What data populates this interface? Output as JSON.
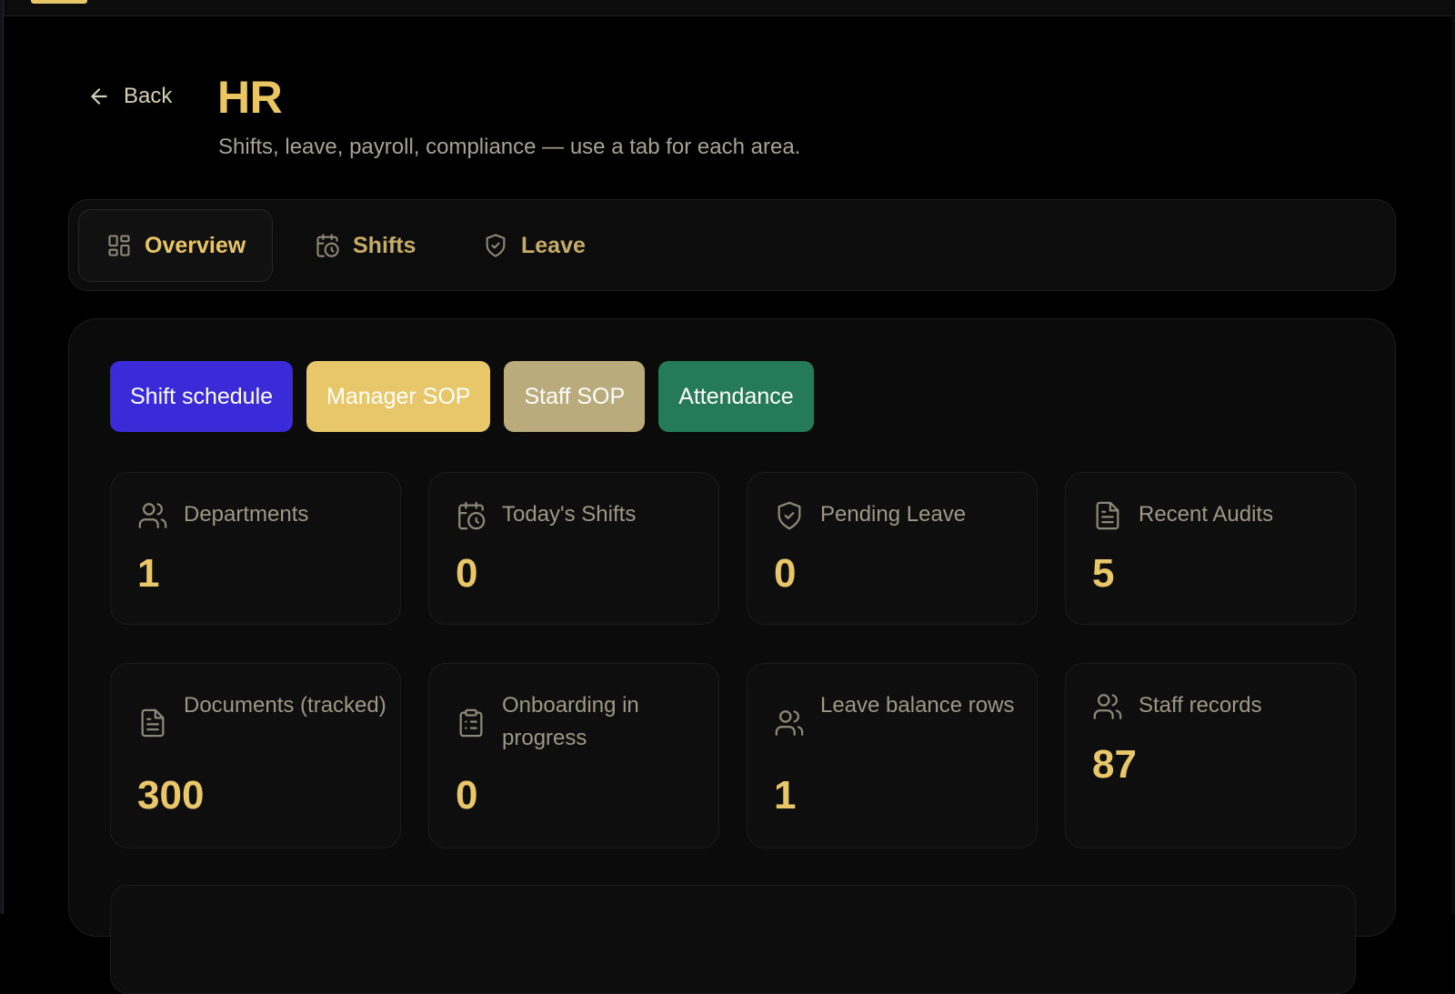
{
  "header": {
    "back_label": "Back",
    "title": "HR",
    "subtitle": "Shifts, leave, payroll, compliance — use a tab for each area."
  },
  "tabs": [
    {
      "label": "Overview",
      "icon": "grid-icon",
      "active": true
    },
    {
      "label": "Shifts",
      "icon": "calendar-clock-icon",
      "active": false
    },
    {
      "label": "Leave",
      "icon": "shield-check-icon",
      "active": false
    }
  ],
  "actions": [
    {
      "label": "Shift schedule",
      "bg": "#3b2ad8",
      "fg": "#ffffff"
    },
    {
      "label": "Manager SOP",
      "bg": "#e7c76a",
      "fg": "#ffffff"
    },
    {
      "label": "Staff SOP",
      "bg": "#b9ab7b",
      "fg": "#ffffff"
    },
    {
      "label": "Attendance",
      "bg": "#267a5c",
      "fg": "#ffffff"
    }
  ],
  "stats": [
    {
      "label": "Departments",
      "value": "1",
      "icon": "users-icon"
    },
    {
      "label": "Today's Shifts",
      "value": "0",
      "icon": "calendar-clock-icon"
    },
    {
      "label": "Pending Leave",
      "value": "0",
      "icon": "shield-check-icon"
    },
    {
      "label": "Recent Audits",
      "value": "5",
      "icon": "file-text-icon"
    },
    {
      "label": "Documents (tracked)",
      "value": "300",
      "icon": "file-text-icon"
    },
    {
      "label": "Onboarding in progress",
      "value": "0",
      "icon": "clipboard-list-icon"
    },
    {
      "label": "Leave balance rows",
      "value": "1",
      "icon": "users-icon"
    },
    {
      "label": "Staff records",
      "value": "87",
      "icon": "users-icon"
    }
  ],
  "colors": {
    "accent": "#e9c65f",
    "background": "#000000",
    "card": "#0e0e0e"
  }
}
